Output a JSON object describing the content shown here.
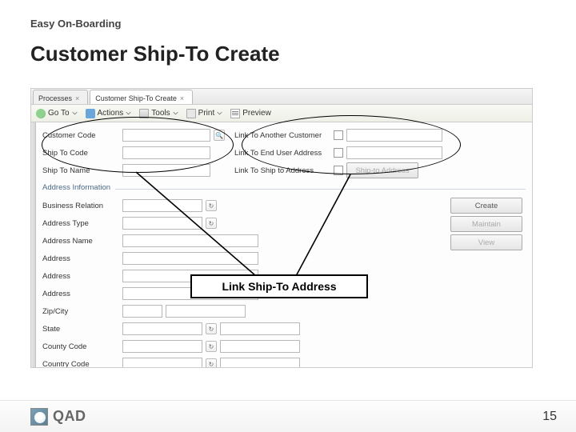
{
  "supertitle": "Easy On-Boarding",
  "title": "Customer Ship-To Create",
  "tabs": [
    {
      "label": "Processes",
      "active": false
    },
    {
      "label": "Customer Ship-To Create",
      "active": true
    }
  ],
  "toolbar": {
    "goto": "Go To",
    "actions": "Actions",
    "tools": "Tools",
    "print": "Print",
    "preview": "Preview"
  },
  "form_top": {
    "rows": [
      {
        "left_label": "Customer Code",
        "left_lookup": true,
        "right_label": "Link To Another Customer",
        "right_input": true
      },
      {
        "left_label": "Ship To Code",
        "left_lookup": false,
        "right_label": "Link To End User Address",
        "right_input": true
      },
      {
        "left_label": "Ship To Name",
        "left_lookup": false,
        "right_label": "Link To Ship to Address",
        "right_input": false,
        "right_button": "Ship-to Address"
      }
    ]
  },
  "section": "Address Information",
  "addr_left_labels": [
    "Business Relation",
    "Address Type",
    "Address Name",
    "Address",
    "Address",
    "Address",
    "Zip/City",
    "State",
    "County Code",
    "Country Code"
  ],
  "addr_right_buttons": [
    "Create",
    "Maintain",
    "View"
  ],
  "callout": "Link Ship-To Address",
  "footer": {
    "brand": "QAD",
    "page": "15"
  }
}
